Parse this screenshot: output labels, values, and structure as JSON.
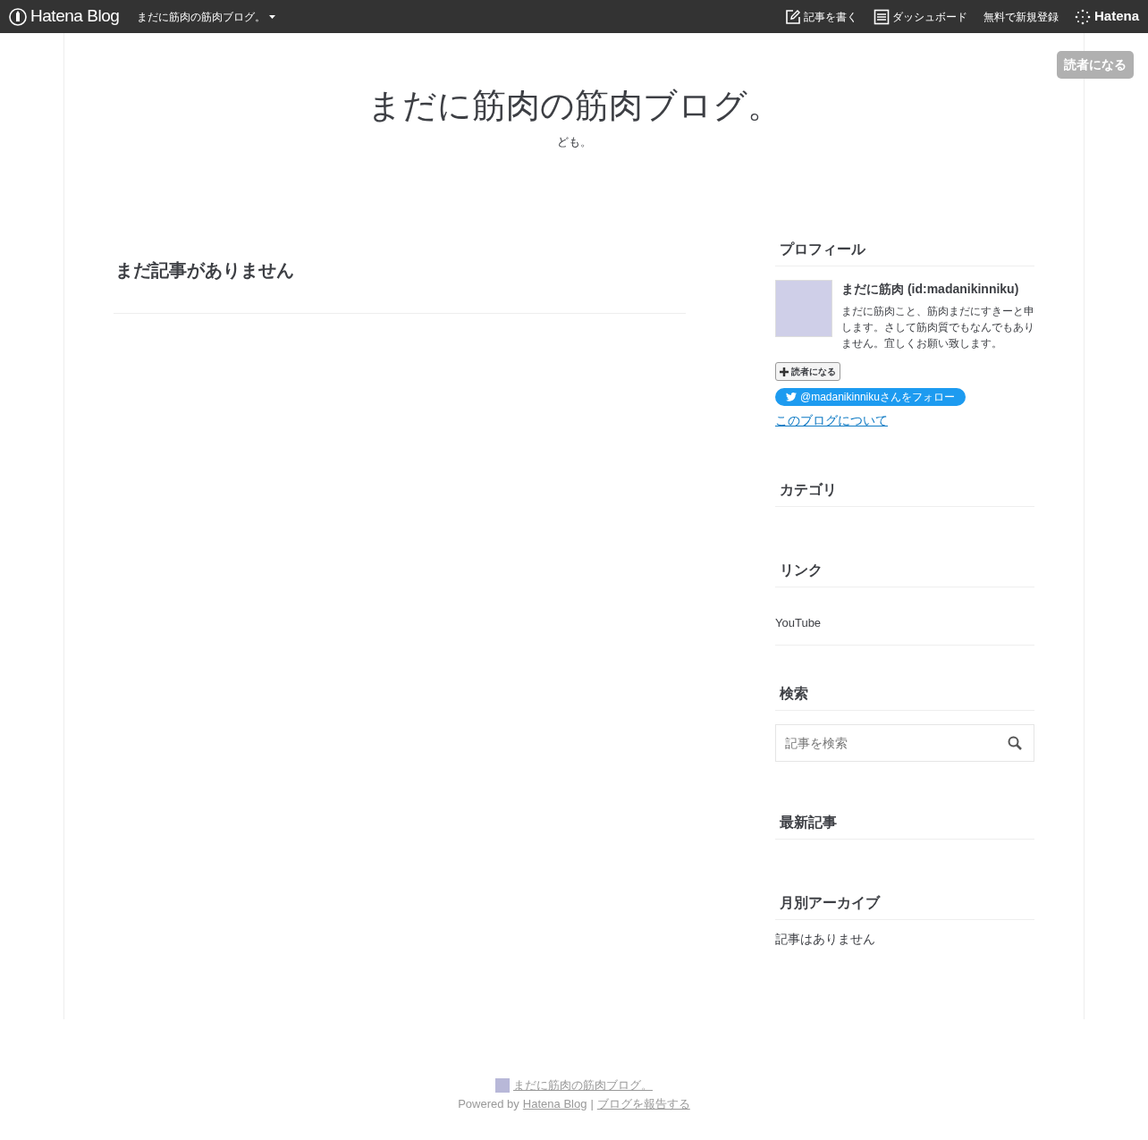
{
  "navbar": {
    "logo_text": "Hatena Blog",
    "blog_menu": "まだに筋肉の筋肉ブログ。",
    "links": [
      {
        "kind": "write",
        "label": "記事を書く"
      },
      {
        "kind": "dashboard",
        "label": "ダッシュボード"
      },
      {
        "kind": "plain",
        "label": "無料で新規登録"
      }
    ],
    "brand": "Hatena"
  },
  "subscribe_button": "読者になる",
  "header": {
    "title": "まだに筋肉の筋肉ブログ。",
    "description": "ども。"
  },
  "main": {
    "empty_message": "まだ記事がありません"
  },
  "sidebar": [
    {
      "kind": "profile",
      "title": "プロフィール",
      "name": "まだに筋肉 (id:madanikinniku)",
      "bio": "まだに筋肉こと、筋肉まだにすきーと申します。さして筋肉質でもなんでもありません。宜しくお願い致します。",
      "subscribe": "読者になる",
      "follow": "@madanikinnikuさんをフォロー",
      "about": "このブログについて"
    },
    {
      "kind": "empty",
      "title": "カテゴリ"
    },
    {
      "kind": "list",
      "title": "リンク",
      "items": [
        "YouTube"
      ]
    },
    {
      "kind": "search",
      "title": "検索",
      "placeholder": "記事を検索"
    },
    {
      "kind": "empty",
      "title": "最新記事"
    },
    {
      "kind": "text",
      "title": "月別アーカイブ",
      "text": "記事はありません"
    }
  ],
  "footer": {
    "blog_link": "まだに筋肉の筋肉ブログ。",
    "powered_by": "Powered by",
    "hatena_link": "Hatena Blog",
    "separator": "|",
    "report_link": "ブログを報告する"
  }
}
